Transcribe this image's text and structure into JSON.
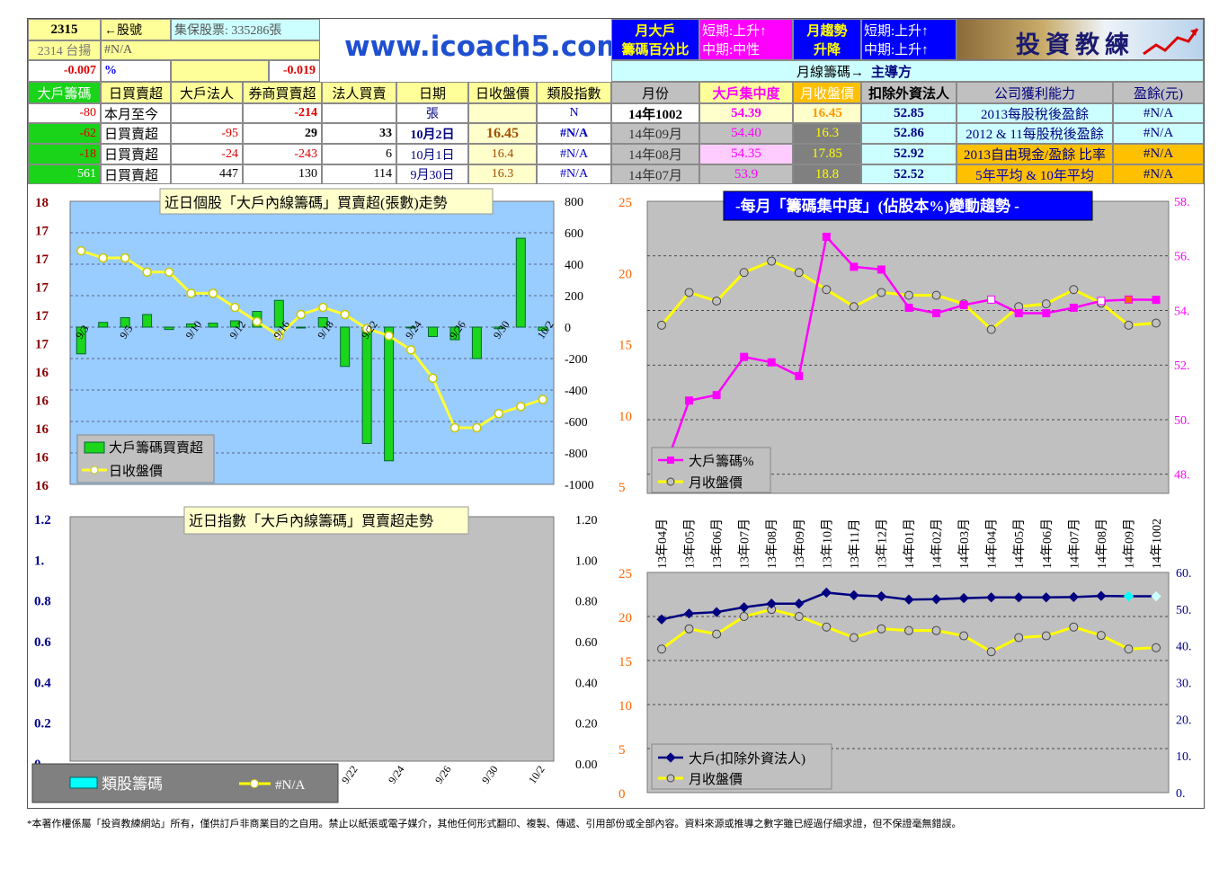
{
  "header": {
    "stock_code": "2315",
    "stock_code_label": "←股號",
    "tdcc_shares": "集保股票: 335286張",
    "ref_index": "2314 台揚",
    "ref_value": "#N/A",
    "change1": "-0.007",
    "pct": "%",
    "change2": "-0.019",
    "website": "www.icoach5.com",
    "big_holder_title1": "月大戶",
    "big_holder_title2": "籌碼百分比",
    "short_term1": "短期:上升↑",
    "mid_term1": "中期:中性",
    "monthly_trend1": "月趨勢",
    "monthly_trend2": "升降",
    "short_term2": "短期:上升↑",
    "mid_term2": "中期:上升↑",
    "logo_text": "投資教練",
    "monthly_chips": "月線籌碼→",
    "dominant": "主導方"
  },
  "colors": {
    "green": "#19d419",
    "magenta": "#ff00ff",
    "navy": "#000080",
    "yellow": "#ffff00",
    "gold": "#ffc000"
  },
  "left_table": {
    "headers": [
      "大戶籌碼",
      "日買賣超",
      "大戶法人",
      "券商買賣超",
      "法人買賣",
      "日期",
      "日收盤價",
      "類股指數"
    ],
    "rows": [
      [
        "-80",
        "本月至今",
        "",
        "-214",
        "",
        "張",
        "",
        "N"
      ],
      [
        "-62",
        "日買賣超",
        "-95",
        "29",
        "33",
        "10月2日",
        "16.45",
        "#N/A"
      ],
      [
        "-18",
        "日買賣超",
        "-24",
        "-243",
        "6",
        "10月1日",
        "16.4",
        "#N/A"
      ],
      [
        "561",
        "日買賣超",
        "447",
        "130",
        "114",
        "9月30日",
        "16.3",
        "#N/A"
      ]
    ]
  },
  "right_table": {
    "headers": [
      "月份",
      "大戶集中度",
      "月收盤價",
      "扣除外資法人",
      "公司獲利能力",
      "盈餘(元)"
    ],
    "rows": [
      [
        "14年1002",
        "54.39",
        "16.45",
        "52.85",
        "2013每股稅後盈餘",
        "#N/A"
      ],
      [
        "14年09月",
        "54.40",
        "16.3",
        "52.86",
        "2012 & 11每股稅後盈餘",
        "#N/A"
      ],
      [
        "14年08月",
        "54.35",
        "17.85",
        "52.92",
        "2013自由現金/盈餘 比率",
        "#N/A"
      ],
      [
        "14年07月",
        "53.9",
        "18.8",
        "52.52",
        "5年平均 & 10年平均",
        "#N/A"
      ]
    ]
  },
  "chart1_title": "近日個股「大戶內線籌碼」買賣超(張數)走勢",
  "chart2_title": "-每月「籌碼集中度」(佔股本%)變動趨勢 -",
  "chart3_title": "近日指數「大戶內線籌碼」買賣超走勢",
  "footer": "*本著作權係屬「投資教練網站」所有，僅供訂戶非商業目的之自用。禁止以紙張或電子媒介，其他任何形式翻印、複製、傳遞、引用部份或全部內容。資料來源或推導之數字雖已經過仔細求證，但不保證毫無錯誤。",
  "chart_data": [
    {
      "type": "bar",
      "title": "近日個股「大戶內線籌碼」買賣超(張數)走勢",
      "categories": [
        "9/3",
        "9/4",
        "9/5",
        "9/8",
        "9/9",
        "9/10",
        "9/11",
        "9/12",
        "9/15",
        "9/16",
        "9/17",
        "9/18",
        "9/19",
        "9/22",
        "9/23",
        "9/24",
        "9/25",
        "9/26",
        "9/29",
        "9/30",
        "10/1",
        "10/2"
      ],
      "x_tick_labels": [
        "9/3",
        "9/5",
        "9/10",
        "9/12",
        "9/16",
        "9/18",
        "9/22",
        "9/24",
        "9/26",
        "9/30",
        "10/2"
      ],
      "series": [
        {
          "name": "大戶籌碼買賣超",
          "axis": "right",
          "values": [
            -170,
            30,
            60,
            80,
            -15,
            20,
            25,
            40,
            100,
            170,
            -5,
            60,
            -250,
            -740,
            -850,
            -5,
            -60,
            -80,
            -200,
            -10,
            565,
            -20
          ]
        },
        {
          "name": "日收盤價",
          "type": "line",
          "axis": "left",
          "values": [
            17.65,
            17.6,
            17.6,
            17.5,
            17.5,
            17.35,
            17.35,
            17.25,
            17.15,
            17.05,
            17.2,
            17.25,
            17.2,
            17.1,
            17.05,
            16.95,
            16.75,
            16.4,
            16.4,
            16.5,
            16.55,
            16.6
          ]
        }
      ],
      "y_left_ticks": [
        "18",
        "17",
        "17",
        "17",
        "17",
        "17",
        "16",
        "16",
        "16",
        "16",
        "16"
      ],
      "y_right_ticks": [
        "800",
        "600",
        "400",
        "200",
        "0",
        "-200",
        "-400",
        "-600",
        "-800",
        "-1000"
      ],
      "ylim_right": [
        -1000,
        800
      ],
      "ylim_left": [
        16.0,
        18.0
      ]
    },
    {
      "type": "line",
      "title": "-每月「籌碼集中度」(佔股本%)變動趨勢 -",
      "categories": [
        "13年04月",
        "13年05月",
        "13年06月",
        "13年07月",
        "13年08月",
        "13年09月",
        "13年10月",
        "13年11月",
        "13年12月",
        "14年01月",
        "14年02月",
        "14年03月",
        "14年04月",
        "14年05月",
        "14年06月",
        "14年07月",
        "14年08月",
        "14年09月",
        "14年1002"
      ],
      "series": [
        {
          "name": "大戶籌碼%",
          "axis": "right",
          "values": [
            47.9,
            50.7,
            50.9,
            52.3,
            52.1,
            51.6,
            56.7,
            55.6,
            55.5,
            54.1,
            53.9,
            54.2,
            54.4,
            53.9,
            53.9,
            54.1,
            54.35,
            54.4,
            54.39
          ]
        },
        {
          "name": "月收盤價",
          "axis": "left",
          "values": [
            16.3,
            18.6,
            18.0,
            20.0,
            20.8,
            20.0,
            18.8,
            17.6,
            18.6,
            18.4,
            18.4,
            17.8,
            16.0,
            17.6,
            17.8,
            18.8,
            17.85,
            16.3,
            16.45
          ]
        }
      ],
      "y_left_ticks": [
        "25",
        "20",
        "15",
        "10",
        "5"
      ],
      "y_right_ticks": [
        "58.",
        "56.",
        "54.",
        "52.",
        "50.",
        "48."
      ],
      "ylim_left": [
        5,
        25
      ],
      "ylim_right": [
        47.3,
        58
      ]
    },
    {
      "type": "bar",
      "title": "近日指數「大戶內線籌碼」買賣超走勢",
      "series": [
        {
          "name": "類股籌碼",
          "values": []
        },
        {
          "name": "#N/A",
          "type": "line",
          "values": []
        }
      ],
      "y_left_ticks": [
        "1.2",
        "1.",
        "0.8",
        "0.6",
        "0.4",
        "0.2",
        "0"
      ],
      "y_right_ticks": [
        "1.20",
        "1.00",
        "0.80",
        "0.60",
        "0.40",
        "0.20",
        "0.00"
      ],
      "x_tick_labels": [
        "9/22",
        "9/24",
        "9/26",
        "9/30",
        "10/2"
      ],
      "ylim": [
        0,
        1.2
      ]
    },
    {
      "type": "line",
      "series": [
        {
          "name": "大戶(扣除外資法人)",
          "axis": "right",
          "values": [
            47.2,
            48.8,
            49.2,
            50.5,
            51.5,
            51.5,
            54.5,
            53.8,
            53.5,
            52.6,
            52.7,
            53.0,
            53.2,
            53.2,
            53.2,
            53.3,
            53.6,
            53.5,
            53.5
          ]
        },
        {
          "name": "月收盤價",
          "axis": "left",
          "values": [
            16.3,
            18.6,
            18.0,
            20.0,
            20.8,
            20.0,
            18.8,
            17.6,
            18.6,
            18.4,
            18.4,
            17.8,
            16.0,
            17.6,
            17.8,
            18.8,
            17.85,
            16.3,
            16.45
          ]
        }
      ],
      "y_left_ticks": [
        "25",
        "20",
        "15",
        "10",
        "5",
        "0"
      ],
      "y_right_ticks": [
        "60.",
        "50.",
        "40.",
        "30.",
        "20.",
        "10.",
        "0."
      ],
      "ylim_left": [
        0,
        25
      ],
      "ylim_right": [
        0,
        60
      ]
    }
  ]
}
